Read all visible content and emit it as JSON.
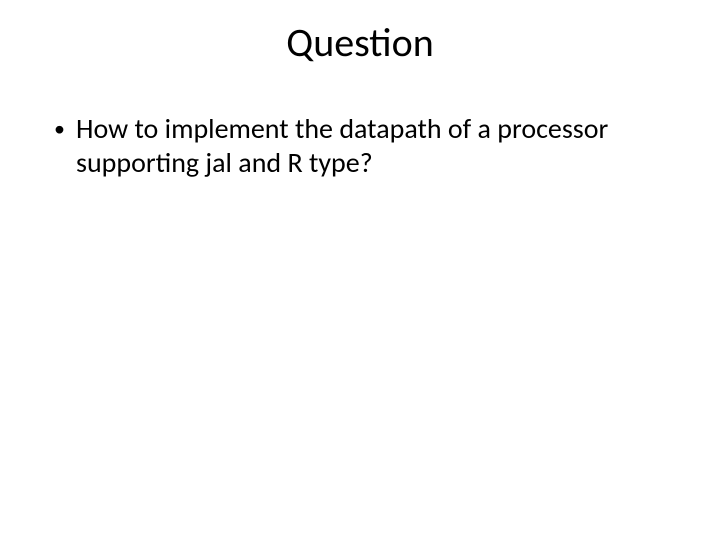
{
  "title": "Question",
  "bullets": [
    {
      "marker": "•",
      "text": "How to implement the datapath of a processor supporting jal and R type?"
    }
  ]
}
